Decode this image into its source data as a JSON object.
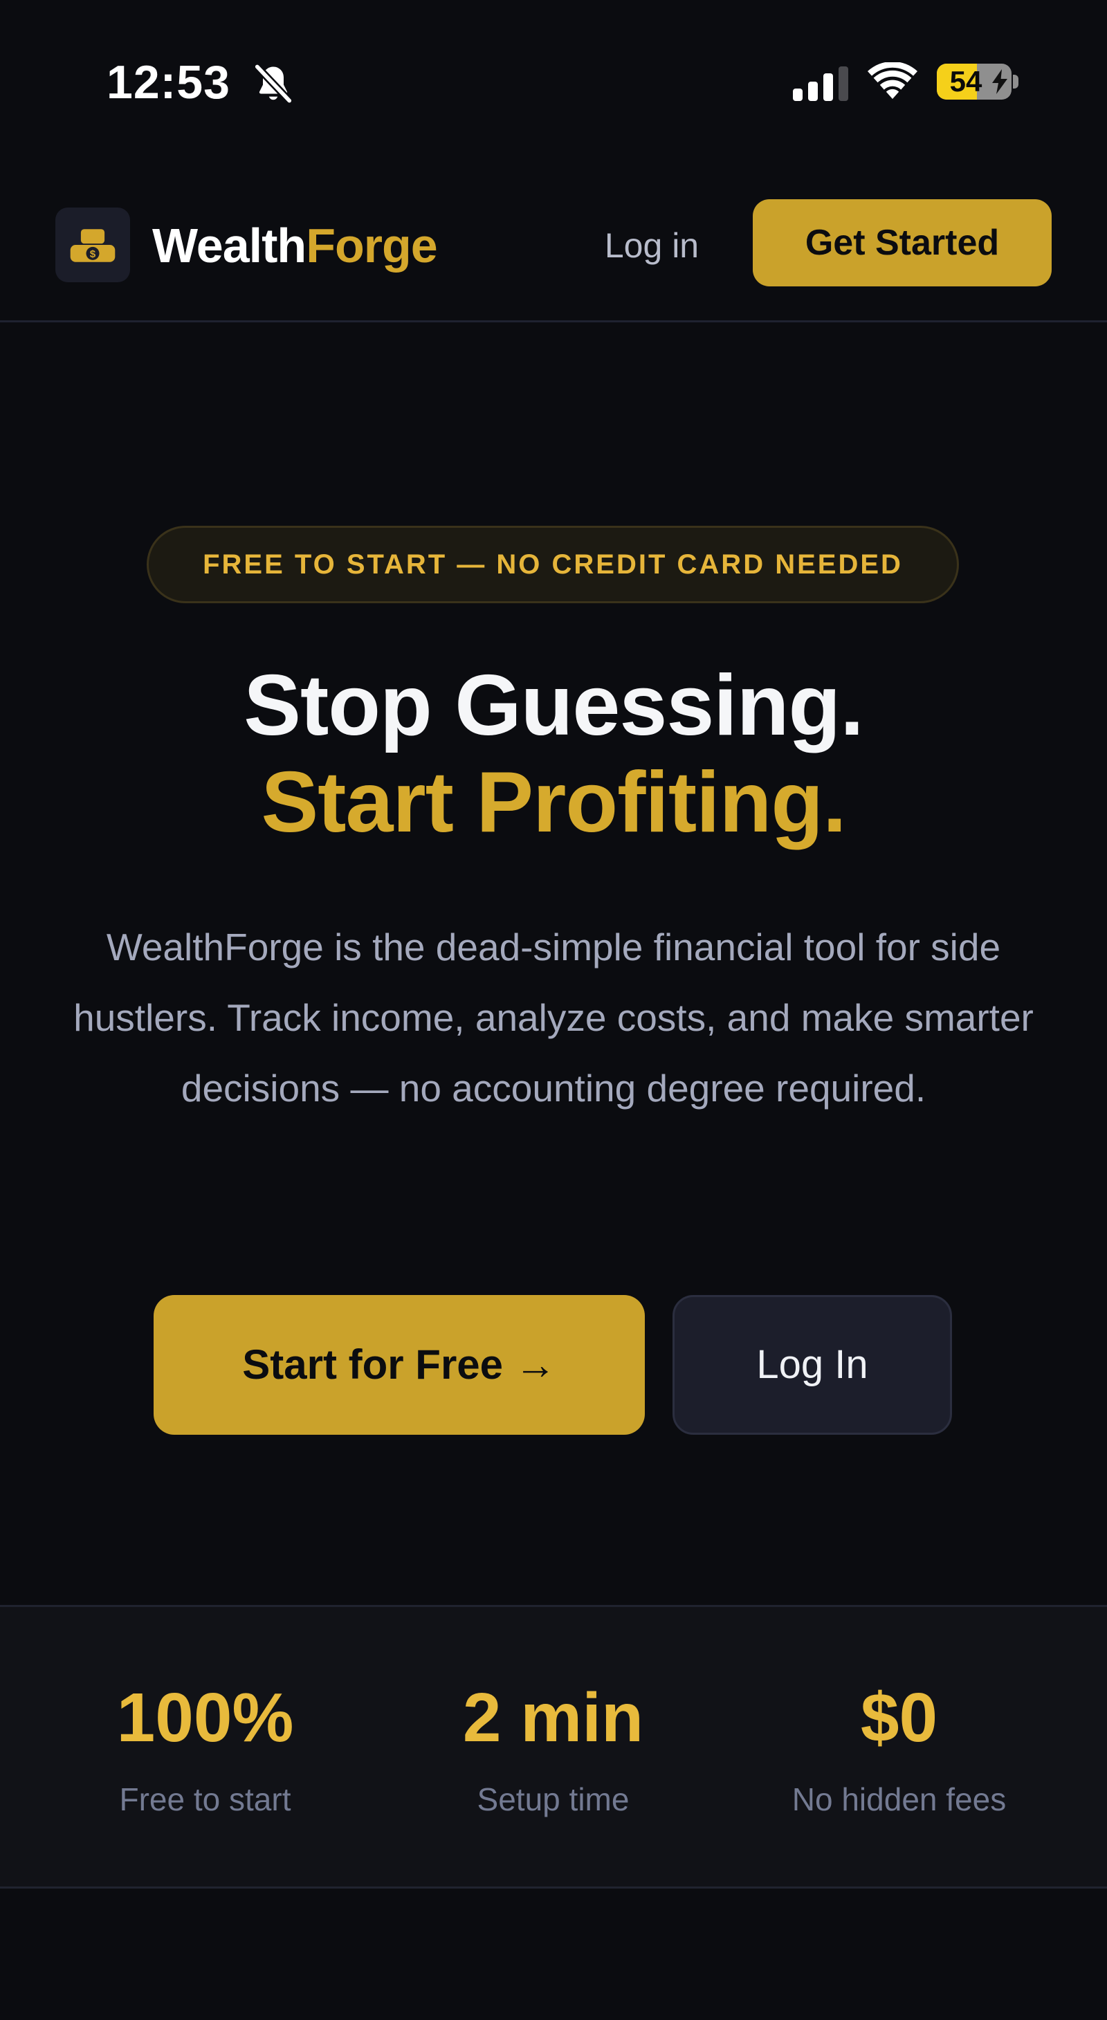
{
  "status_bar": {
    "time": "12:53",
    "battery_percent": "54",
    "battery_level": 0.54,
    "icons": [
      "bell-slash-icon",
      "cellular-signal-icon",
      "wifi-icon",
      "battery-charging-icon"
    ]
  },
  "nav": {
    "brand_part1": "Wealth",
    "brand_part2": "Forge",
    "logo_icon": "gold-bars-icon",
    "login_label": "Log in",
    "cta_label": "Get Started"
  },
  "hero": {
    "badge": "FREE TO START — NO CREDIT CARD NEEDED",
    "headline_line1": "Stop Guessing.",
    "headline_line2": "Start Profiting.",
    "description": "WealthForge is the dead-simple financial tool for side hustlers. Track income, analyze costs, and make smarter decisions — no accounting degree required.",
    "primary_button": "Start for Free →",
    "secondary_button": "Log In"
  },
  "stats": [
    {
      "value": "100%",
      "label": "Free to start"
    },
    {
      "value": "2 min",
      "label": "Setup time"
    },
    {
      "value": "$0",
      "label": "No hidden fees"
    }
  ],
  "colors": {
    "background": "#0b0c10",
    "accent": "#caa22b",
    "accent_text": "#e8ba3c",
    "muted_text": "#a4a9bd",
    "stats_background": "#111217"
  }
}
